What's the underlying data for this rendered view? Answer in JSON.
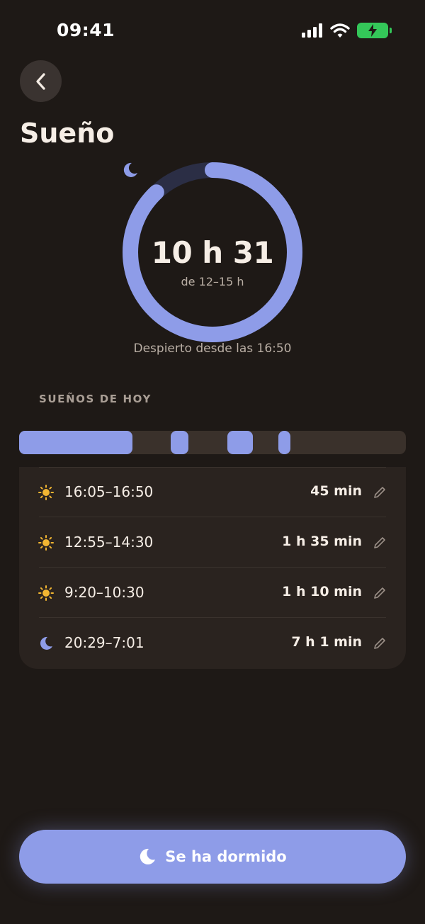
{
  "status_bar": {
    "time": "09:41",
    "icons": [
      "signal-icon",
      "wifi-icon",
      "battery-charging-icon"
    ]
  },
  "header": {
    "back_icon": "chevron-left-icon",
    "title": "Sueño"
  },
  "summary": {
    "total": "10 h 31",
    "target_range": "de 12–15 h",
    "progress_fraction": 0.88,
    "awake_since": "Despierto desde las 16:50",
    "icon": "moon-icon"
  },
  "today": {
    "section_title": "SUEÑOS DE HOY",
    "timeline_segments": [
      {
        "start_fraction": 0.0,
        "end_fraction": 0.293
      },
      {
        "start_fraction": 0.392,
        "end_fraction": 0.438
      },
      {
        "start_fraction": 0.538,
        "end_fraction": 0.604
      },
      {
        "start_fraction": 0.67,
        "end_fraction": 0.701
      }
    ],
    "sessions": [
      {
        "icon": "sun-icon",
        "time": "16:05–16:50",
        "duration": "45 min"
      },
      {
        "icon": "sun-icon",
        "time": "12:55–14:30",
        "duration": "1 h 35 min"
      },
      {
        "icon": "sun-icon",
        "time": "9:20–10:30",
        "duration": "1 h 10 min"
      },
      {
        "icon": "moon-icon",
        "time": "20:29–7:01",
        "duration": "7 h 1 min"
      }
    ]
  },
  "primary_action": {
    "label": "Se ha dormido",
    "icon": "moon-icon"
  },
  "colors": {
    "background": "#1e1916",
    "accent": "#8e9ce8",
    "ring_track": "#2b2e45",
    "sun": "#f2b632",
    "battery": "#34c759"
  }
}
